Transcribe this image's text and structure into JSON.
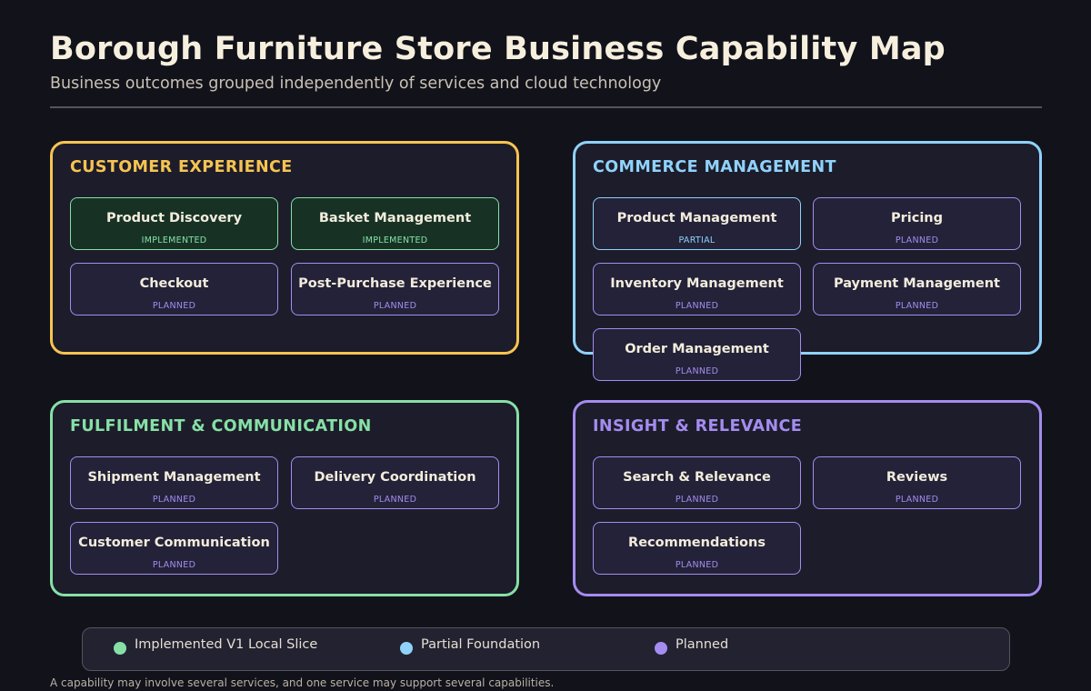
{
  "header": {
    "title": "Borough Furniture Store Business Capability Map",
    "subtitle": "Business outcomes grouped independently of services and cloud technology"
  },
  "colors": {
    "implemented": "#86e0a6",
    "partial": "#8fd2fb",
    "planned": "#a48cf0",
    "customer_experience": "#f6c451",
    "commerce_management": "#8fd2fb",
    "fulfilment_communication": "#86e0a6",
    "insight_relevance": "#a48cf0"
  },
  "groups": [
    {
      "title": "CUSTOMER EXPERIENCE",
      "capabilities": [
        {
          "name": "Product Discovery",
          "status": "IMPLEMENTED"
        },
        {
          "name": "Basket Management",
          "status": "IMPLEMENTED"
        },
        {
          "name": "Checkout",
          "status": "PLANNED"
        },
        {
          "name": "Post-Purchase Experience",
          "status": "PLANNED"
        }
      ]
    },
    {
      "title": "COMMERCE MANAGEMENT",
      "capabilities": [
        {
          "name": "Product Management",
          "status": "PARTIAL"
        },
        {
          "name": "Pricing",
          "status": "PLANNED"
        },
        {
          "name": "Inventory Management",
          "status": "PLANNED"
        },
        {
          "name": "Payment Management",
          "status": "PLANNED"
        },
        {
          "name": "Order Management",
          "status": "PLANNED"
        }
      ]
    },
    {
      "title": "FULFILMENT & COMMUNICATION",
      "capabilities": [
        {
          "name": "Shipment Management",
          "status": "PLANNED"
        },
        {
          "name": "Delivery Coordination",
          "status": "PLANNED"
        },
        {
          "name": "Customer Communication",
          "status": "PLANNED"
        }
      ]
    },
    {
      "title": "INSIGHT & RELEVANCE",
      "capabilities": [
        {
          "name": "Search & Relevance",
          "status": "PLANNED"
        },
        {
          "name": "Reviews",
          "status": "PLANNED"
        },
        {
          "name": "Recommendations",
          "status": "PLANNED"
        }
      ]
    }
  ],
  "legend": {
    "implemented": "Implemented V1 Local Slice",
    "partial": "Partial Foundation",
    "planned": "Planned"
  },
  "footnote": "A capability may involve several services, and one service may support several capabilities."
}
